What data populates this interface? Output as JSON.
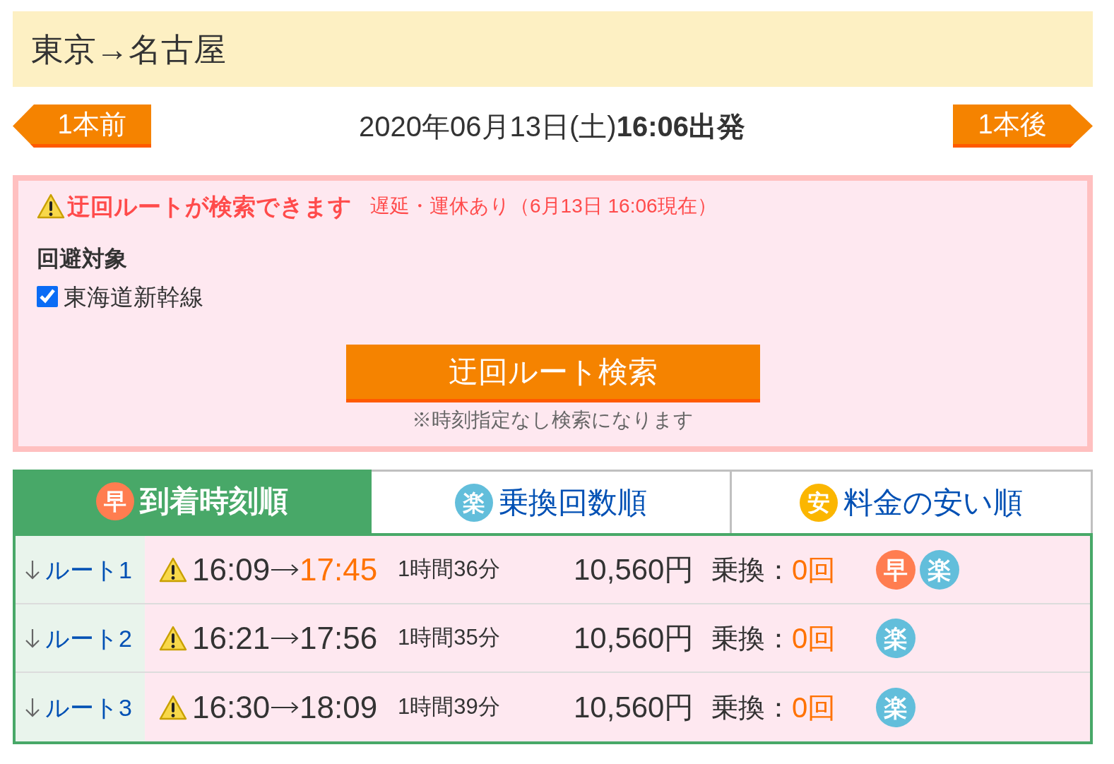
{
  "page_title": "東京→名古屋",
  "nav": {
    "prev": "1本前",
    "departure": "2020年06月13日(土)**16:06出発**",
    "next": "1本後"
  },
  "alert": {
    "title": "迂回ルートが検索できます",
    "status": "遅延・運休あり（6月13日 16:06現在）",
    "avoid_heading": "回避対象",
    "avoid_items": [
      {
        "label": "東海道新幹線",
        "checked": true
      }
    ],
    "search_button": "迂回ルート検索",
    "note": "※時刻指定なし検索になります"
  },
  "sort_tabs": [
    {
      "badge": {
        "text": "早",
        "color": "#ff7d50"
      },
      "label": "到着時刻順",
      "selected": true
    },
    {
      "badge": {
        "text": "楽",
        "color": "#62bedb"
      },
      "label": "乗換回数順",
      "selected": false
    },
    {
      "badge": {
        "text": "安",
        "color": "#fbb600"
      },
      "label": "料金の安い順",
      "selected": false
    }
  ],
  "routes": [
    {
      "label": "ルート1",
      "departure": "16:09",
      "arrival": "17:45",
      "arrival_highlighted": true,
      "duration": "1時間36分",
      "fare": "10,560円",
      "transfers_label": "乗換：",
      "transfers": "0回",
      "badges": [
        {
          "text": "早",
          "color": "#ff7d50"
        },
        {
          "text": "楽",
          "color": "#62bedb"
        }
      ]
    },
    {
      "label": "ルート2",
      "departure": "16:21",
      "arrival": "17:56",
      "arrival_highlighted": false,
      "duration": "1時間35分",
      "fare": "10,560円",
      "transfers_label": "乗換：",
      "transfers": "0回",
      "badges": [
        {
          "text": "楽",
          "color": "#62bedb"
        }
      ]
    },
    {
      "label": "ルート3",
      "departure": "16:30",
      "arrival": "18:09",
      "arrival_highlighted": false,
      "duration": "1時間39分",
      "fare": "10,560円",
      "transfers_label": "乗換：",
      "transfers": "0回",
      "badges": [
        {
          "text": "楽",
          "color": "#62bedb"
        }
      ]
    }
  ]
}
